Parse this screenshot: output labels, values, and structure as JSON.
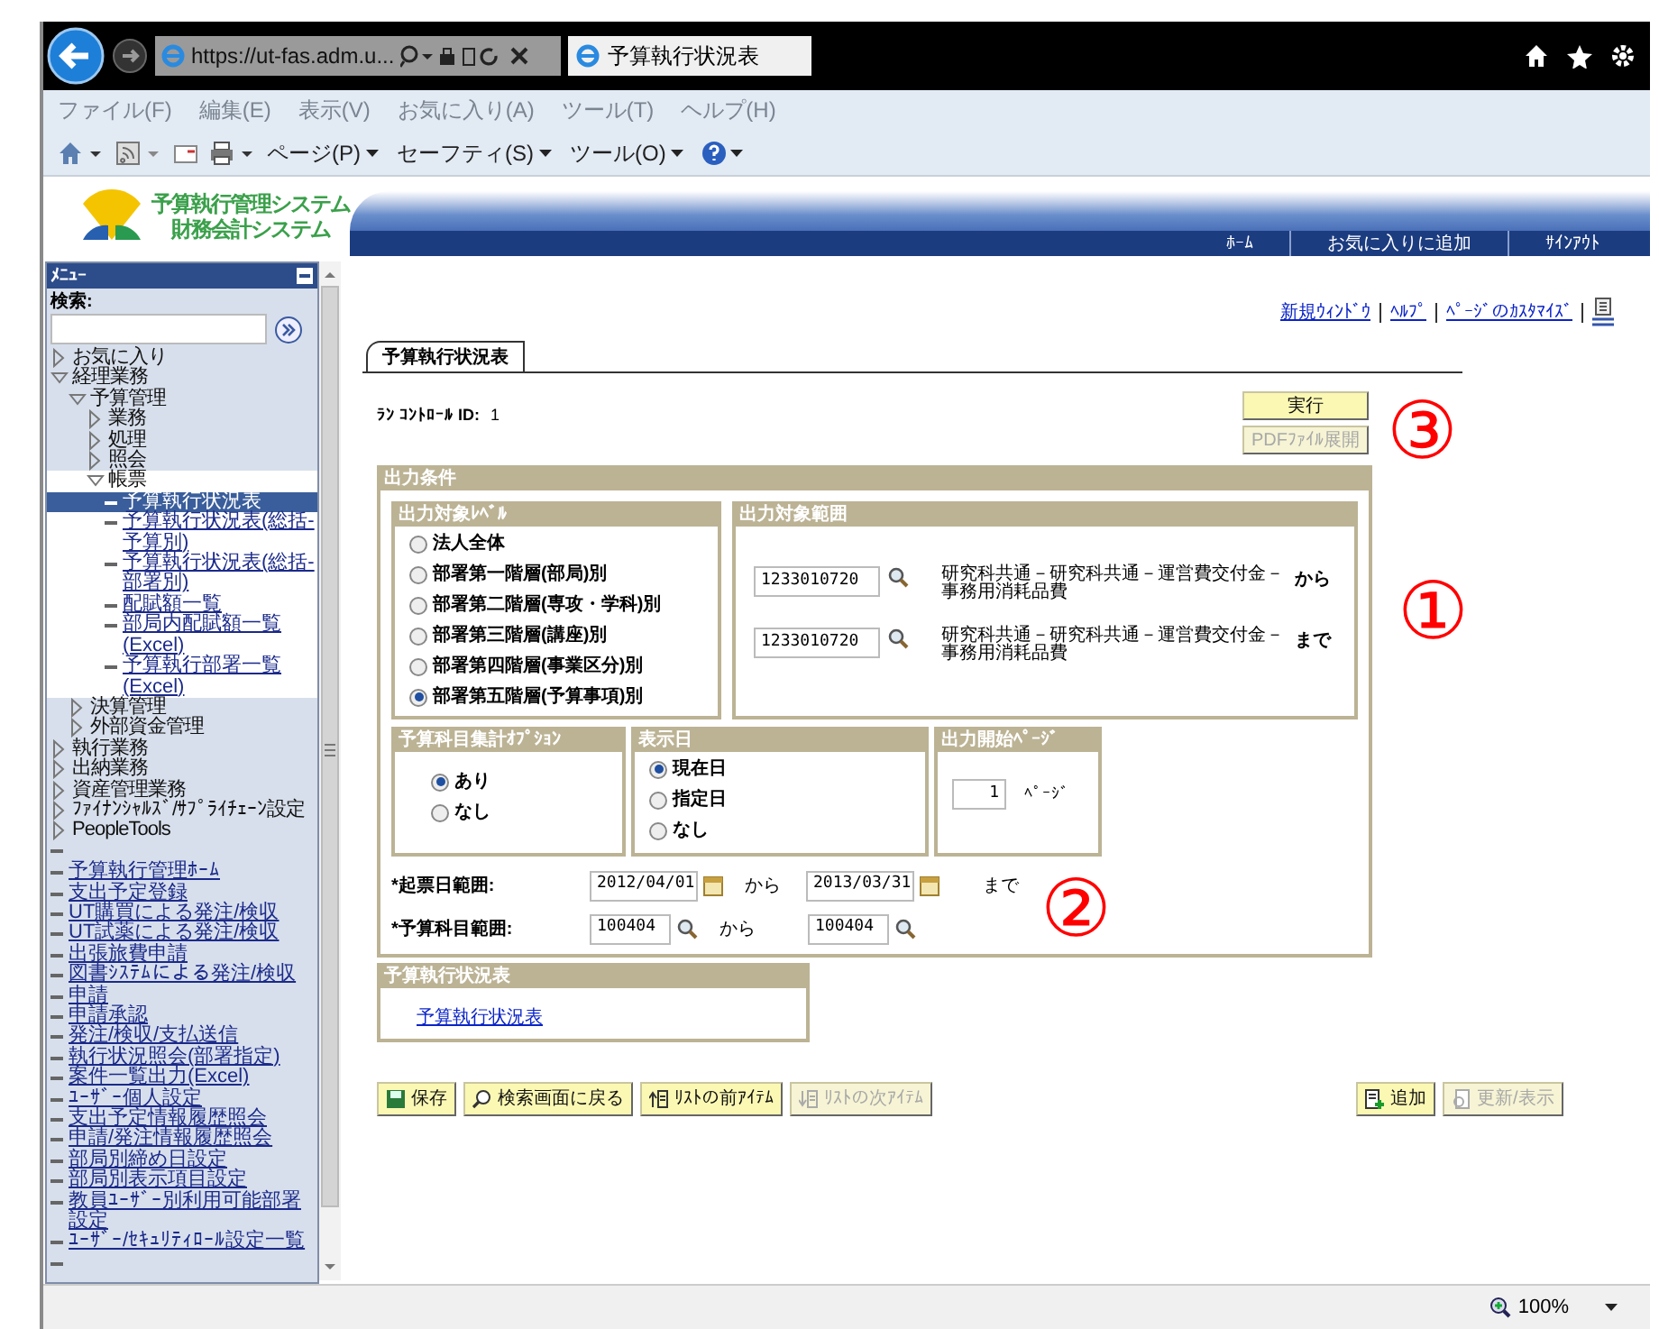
{
  "browser": {
    "address": "https://ut-fas.adm.u...",
    "tab_title": "予算執行状況表",
    "menu": [
      "ファイル(F)",
      "編集(E)",
      "表示(V)",
      "お気に入り(A)",
      "ツール(T)",
      "ヘルプ(H)"
    ],
    "commands": [
      "ページ(P)",
      "セーフティ(S)",
      "ツール(O)"
    ],
    "zoom": "100%"
  },
  "header": {
    "logo_lines": [
      "予算執行管理システム",
      "財務会計システム"
    ],
    "links": [
      "ﾎｰﾑ",
      "お気に入りに追加",
      "ｻｲﾝｱｳﾄ"
    ]
  },
  "sidebar": {
    "title": "ﾒﾆｭｰ",
    "search_label": "検索:",
    "tree": [
      {
        "kind": "folder",
        "label": "お気に入り",
        "expanded": false
      },
      {
        "kind": "folder",
        "label": "経理業務",
        "expanded": true,
        "children": [
          {
            "kind": "folder",
            "label": "予算管理",
            "expanded": true,
            "children": [
              {
                "kind": "folder",
                "label": "業務",
                "expanded": false
              },
              {
                "kind": "folder",
                "label": "処理",
                "expanded": false
              },
              {
                "kind": "folder",
                "label": "照会",
                "expanded": false
              },
              {
                "kind": "folder",
                "label": "帳票",
                "expanded": true,
                "children": [
                  {
                    "kind": "link",
                    "label": "予算執行状況表",
                    "selected": true
                  },
                  {
                    "kind": "link",
                    "label": "予算執行状況表(総括-予算別)",
                    "selected": false
                  },
                  {
                    "kind": "link",
                    "label": "予算執行状況表(総括-部署別)",
                    "selected": false
                  },
                  {
                    "kind": "link",
                    "label": "配賦額一覧",
                    "selected": false
                  },
                  {
                    "kind": "link",
                    "label": "部局内配賦額一覧(Excel)",
                    "selected": false
                  },
                  {
                    "kind": "link",
                    "label": "予算執行部署一覧(Excel)",
                    "selected": false
                  }
                ]
              }
            ]
          },
          {
            "kind": "folder",
            "label": "決算管理",
            "expanded": false
          },
          {
            "kind": "folder",
            "label": "外部資金管理",
            "expanded": false
          }
        ]
      },
      {
        "kind": "folder",
        "label": "執行業務",
        "expanded": false
      },
      {
        "kind": "folder",
        "label": "出納業務",
        "expanded": false
      },
      {
        "kind": "folder",
        "label": "資産管理業務",
        "expanded": false
      },
      {
        "kind": "folder",
        "label": "ﾌｧｲﾅﾝｼｬﾙｽﾞ/ｻﾌﾟﾗｲﾁｪｰﾝ設定",
        "expanded": false
      },
      {
        "kind": "folder",
        "label": "PeopleTools",
        "expanded": false
      },
      {
        "kind": "blank"
      },
      {
        "kind": "link",
        "label": "予算執行管理ﾎｰﾑ",
        "selected": false
      },
      {
        "kind": "link",
        "label": "支出予定登録",
        "selected": false
      },
      {
        "kind": "link",
        "label": "UT購買による発注/検収",
        "selected": false
      },
      {
        "kind": "link",
        "label": "UT試薬による発注/検収",
        "selected": false
      },
      {
        "kind": "link",
        "label": "出張旅費申請",
        "selected": false
      },
      {
        "kind": "link",
        "label": "図書ｼｽﾃﾑによる発注/検収",
        "selected": false
      },
      {
        "kind": "link",
        "label": "申請",
        "selected": false
      },
      {
        "kind": "link",
        "label": "申請承認",
        "selected": false
      },
      {
        "kind": "link",
        "label": "発注/検収/支払送信",
        "selected": false
      },
      {
        "kind": "link",
        "label": "執行状況照会(部署指定)",
        "selected": false
      },
      {
        "kind": "link",
        "label": "案件一覧出力(Excel)",
        "selected": false
      },
      {
        "kind": "link",
        "label": "ﾕｰｻﾞｰ個人設定",
        "selected": false
      },
      {
        "kind": "link",
        "label": "支出予定情報履歴照会",
        "selected": false
      },
      {
        "kind": "link",
        "label": "申請/発注情報履歴照会",
        "selected": false
      },
      {
        "kind": "link",
        "label": "部局別締め日設定",
        "selected": false
      },
      {
        "kind": "link",
        "label": "部局別表示項目設定",
        "selected": false
      },
      {
        "kind": "link",
        "label": "教員ﾕｰｻﾞｰ別利用可能部署設定",
        "selected": false
      },
      {
        "kind": "link",
        "label": "ﾕｰｻﾞｰ/ｾｷｭﾘﾃｨﾛｰﾙ設定一覧",
        "selected": false
      },
      {
        "kind": "blank"
      }
    ]
  },
  "page": {
    "links": [
      "新規ｳｨﾝﾄﾞｳ",
      "ﾍﾙﾌﾟ",
      "ﾍﾟｰｼﾞのｶｽﾀﾏｲｽﾞ"
    ],
    "tab": {
      "label": "予算執行状況表",
      "selected": true
    },
    "run_control": {
      "label": "ﾗﾝ ｺﾝﾄﾛｰﾙ ID:",
      "value": "1"
    },
    "actions": [
      {
        "label": "実行",
        "disabled": false
      },
      {
        "label": "PDFﾌｧｲﾙ展開",
        "disabled": true
      }
    ],
    "conditions": {
      "title": "出力条件",
      "level": {
        "title": "出力対象ﾚﾍﾞﾙ",
        "options": [
          {
            "label": "法人全体",
            "selected": false
          },
          {
            "label": "部署第一階層(部局)別",
            "selected": false
          },
          {
            "label": "部署第二階層(専攻・学科)別",
            "selected": false
          },
          {
            "label": "部署第三階層(講座)別",
            "selected": false
          },
          {
            "label": "部署第四階層(事業区分)別",
            "selected": false
          },
          {
            "label": "部署第五階層(予算事項)別",
            "selected": true
          }
        ]
      },
      "range": {
        "title": "出力対象範囲",
        "rows": [
          {
            "value": "1233010720",
            "description": "研究科共通－研究科共通－運営費交付金－事務用消耗品費",
            "suffix": "から"
          },
          {
            "value": "1233010720",
            "description": "研究科共通－研究科共通－運営費交付金－事務用消耗品費",
            "suffix": "まで"
          }
        ]
      },
      "option": {
        "title": "予算科目集計ｵﾌﾟｼｮﾝ",
        "options": [
          {
            "label": "あり",
            "selected": true
          },
          {
            "label": "なし",
            "selected": false
          }
        ]
      },
      "display_date": {
        "title": "表示日",
        "options": [
          {
            "label": "現在日",
            "selected": true
          },
          {
            "label": "指定日",
            "selected": false
          },
          {
            "label": "なし",
            "selected": false
          }
        ]
      },
      "start_page": {
        "title": "出力開始ﾍﾟｰｼﾞ",
        "value": "1",
        "unit": "ﾍﾟｰｼﾞ"
      },
      "ranges": [
        {
          "label": "*起票日範囲:",
          "kind": "date",
          "from": "2012/04/01",
          "middle": "から",
          "to": "2013/03/31",
          "end": "まで"
        },
        {
          "label": "*予算科目範囲:",
          "kind": "lookup",
          "from": "100404",
          "middle": "から",
          "to": "100404"
        }
      ]
    },
    "report": {
      "title": "予算執行状況表",
      "link": "予算執行状況表"
    },
    "buttons": [
      {
        "label": "保存",
        "disabled": false
      },
      {
        "label": "検索画面に戻る",
        "disabled": false
      },
      {
        "label": "ﾘｽﾄの前ｱｲﾃﾑ",
        "disabled": false
      },
      {
        "label": "ﾘｽﾄの次ｱｲﾃﾑ",
        "disabled": true
      }
    ],
    "right_buttons": [
      {
        "label": "追加",
        "disabled": false
      },
      {
        "label": "更新/表示",
        "disabled": true
      }
    ]
  },
  "annotations": [
    "③",
    "①",
    "②"
  ]
}
